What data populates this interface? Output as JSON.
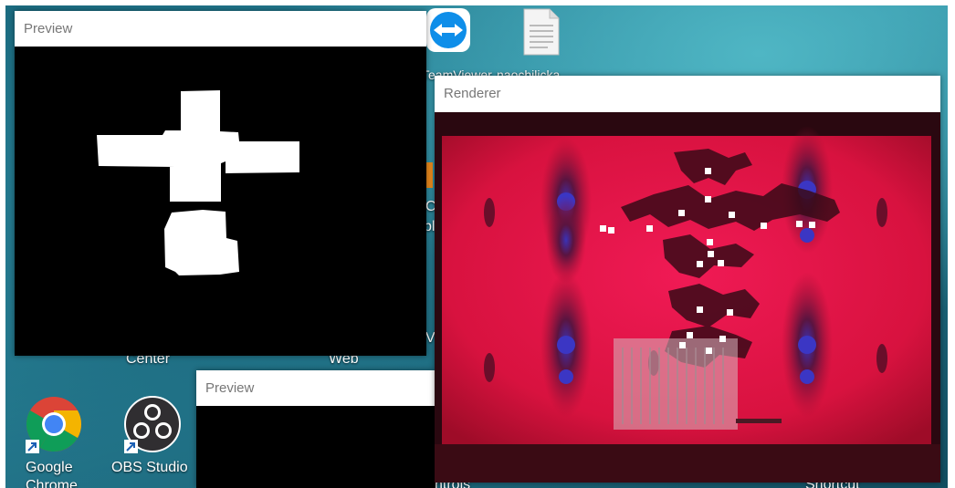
{
  "desktop": {
    "icons": {
      "chrome_label": "Google",
      "chrome_label_line2": "Chrome",
      "obs_label": "OBS Studio",
      "teamviewer_label": "TeamViewer",
      "document_label": "naochilicka"
    },
    "partial_labels": {
      "center": "Center",
      "web": "Web",
      "controls": "ntrols",
      "shortcut": "Shortcut",
      "c_letter": "C",
      "b_letter": "bl",
      "v_letter": "V"
    }
  },
  "windows": {
    "preview_main": {
      "title": "Preview"
    },
    "renderer": {
      "title": "Renderer"
    },
    "preview_small": {
      "title": "Preview"
    }
  },
  "colors": {
    "projection_red": "#e8184a",
    "mask_white": "#ffffff",
    "window_black": "#000000"
  }
}
